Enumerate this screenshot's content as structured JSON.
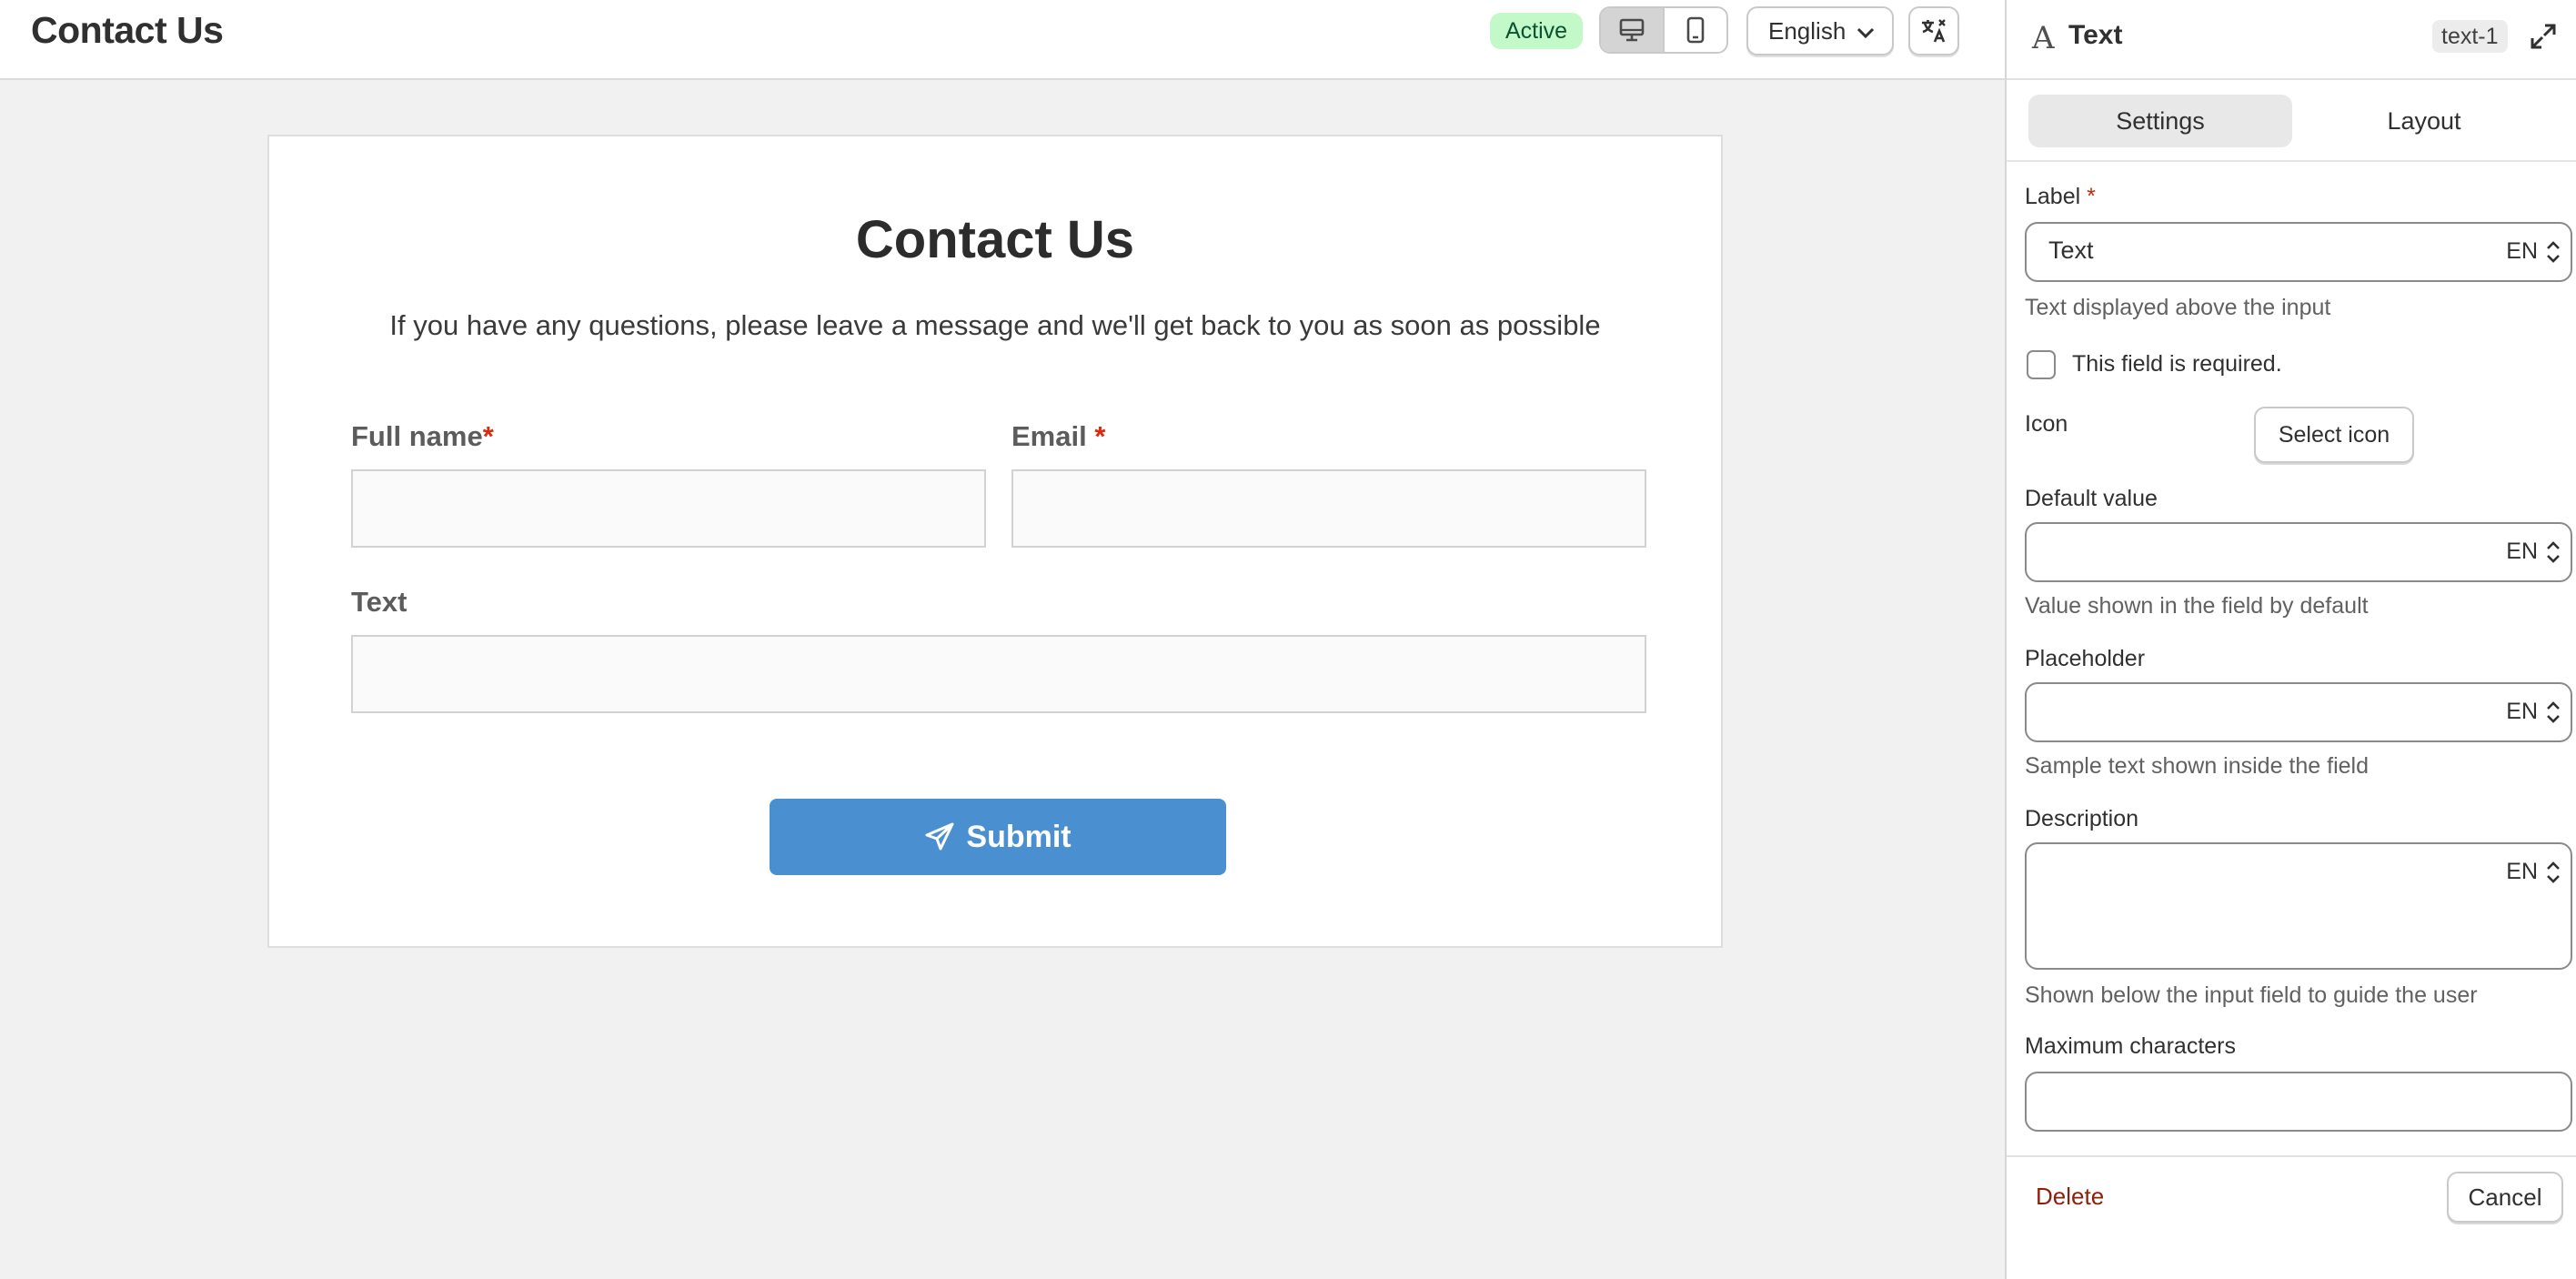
{
  "topbar": {
    "title": "Contact Us",
    "status_badge": "Active",
    "language": "English"
  },
  "form": {
    "title": "Contact Us",
    "subtitle": "If you have any questions, please leave a message and we'll get back to you as soon as possible",
    "fields": [
      {
        "label": "Full name",
        "required_mark": "*"
      },
      {
        "label": "Email",
        "required_mark": "*"
      },
      {
        "label": "Text",
        "required_mark": ""
      }
    ],
    "submit_label": "Submit"
  },
  "panel": {
    "type_icon": "A",
    "title": "Text",
    "element_id": "text-1",
    "tabs": [
      {
        "label": "Settings",
        "active": true
      },
      {
        "label": "Layout",
        "active": false
      }
    ],
    "label_field": {
      "label": "Label",
      "required_mark": "*",
      "value": "Text",
      "lang": "EN",
      "help": "Text displayed above the input"
    },
    "required_checkbox": {
      "label": "This field is required.",
      "checked": false
    },
    "icon_field": {
      "label": "Icon",
      "button": "Select icon"
    },
    "default_value": {
      "label": "Default value",
      "value": "",
      "lang": "EN",
      "help": "Value shown in the field by default"
    },
    "placeholder": {
      "label": "Placeholder",
      "value": "",
      "lang": "EN",
      "help": "Sample text shown inside the field"
    },
    "description": {
      "label": "Description",
      "value": "",
      "lang": "EN",
      "help": "Shown below the input field to guide the user"
    },
    "max_chars": {
      "label": "Maximum characters",
      "value": ""
    },
    "delete_label": "Delete",
    "cancel_label": "Cancel"
  },
  "colors": {
    "accent_button": "#4a90d0",
    "required": "#d72c0d",
    "badge_bg": "#c3f9c8",
    "delete": "#8e1f0b"
  },
  "icons": [
    "desktop-icon",
    "mobile-icon",
    "chevron-down-icon",
    "translate-icon",
    "text-type-icon",
    "expand-icon",
    "send-icon",
    "updown-chevron-icon"
  ]
}
